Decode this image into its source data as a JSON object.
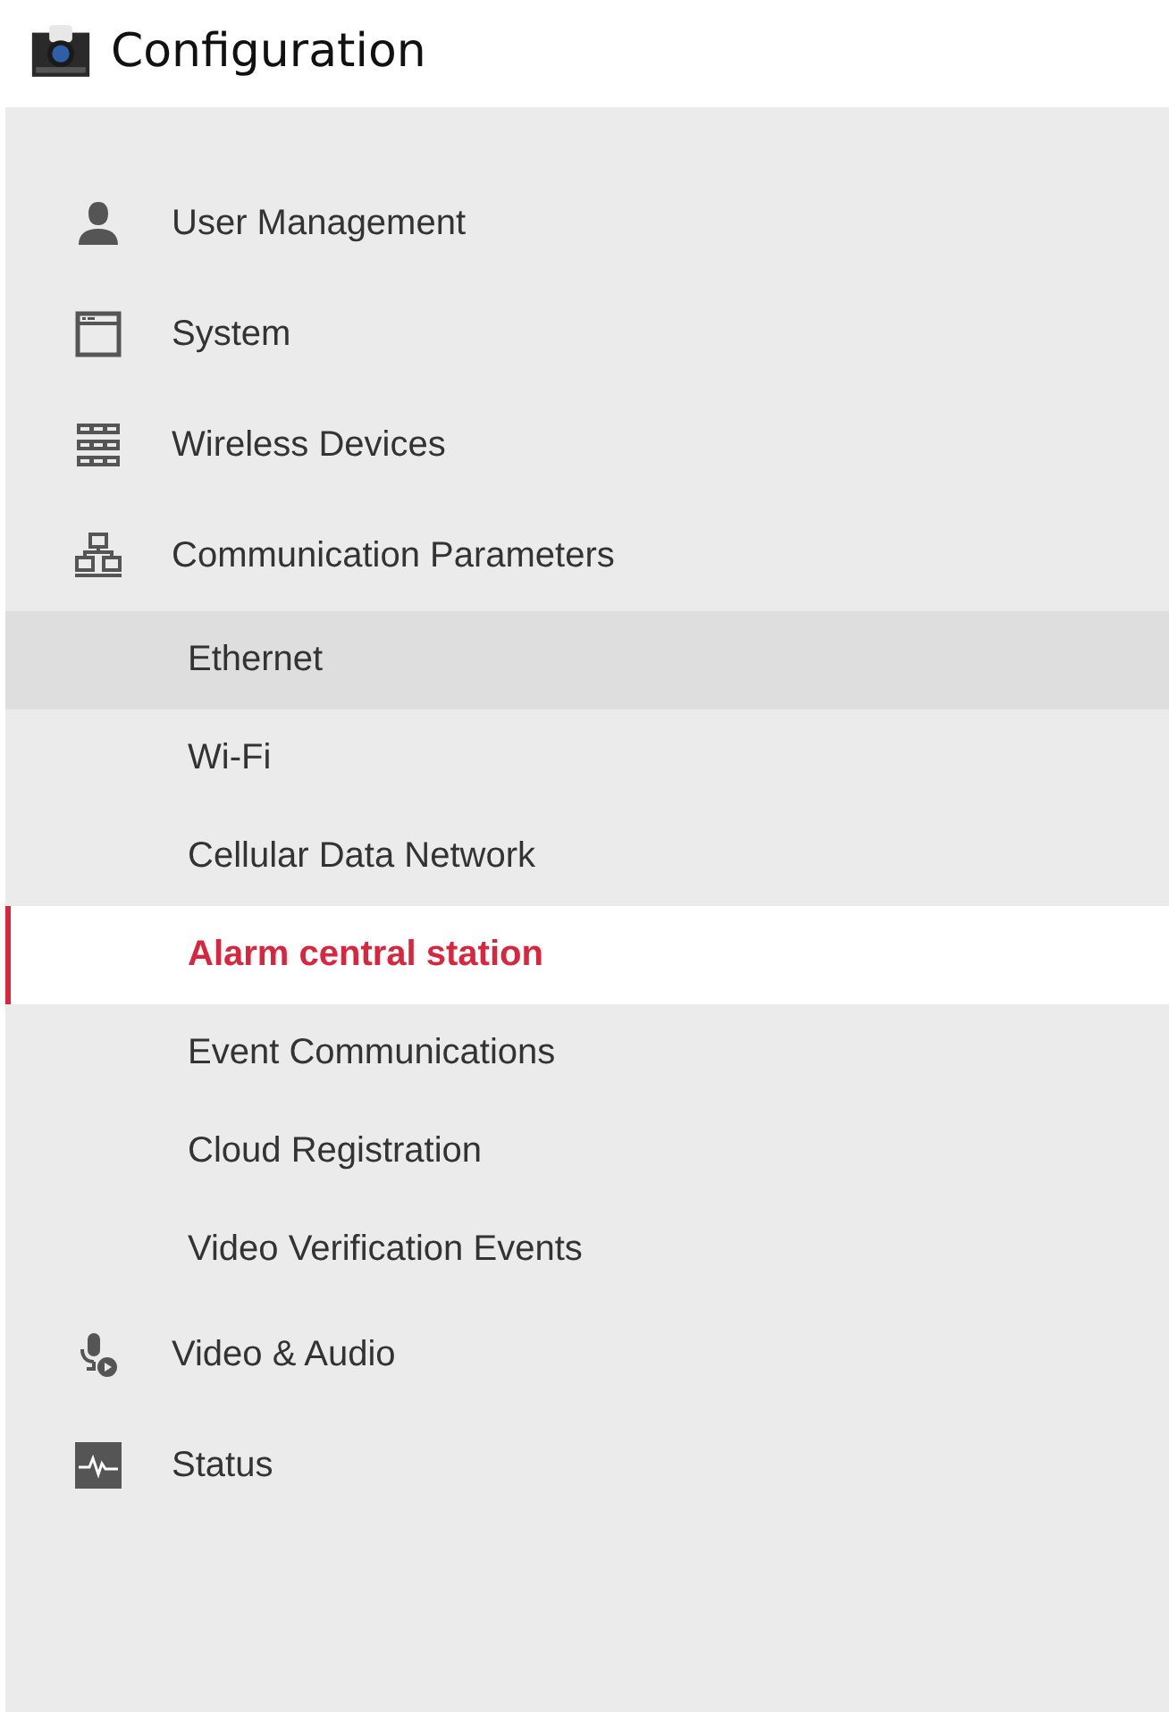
{
  "header": {
    "title": "Configuration"
  },
  "menu": [
    {
      "label": "User Management"
    },
    {
      "label": "System"
    },
    {
      "label": "Wireless Devices"
    },
    {
      "label": "Communication Parameters",
      "children": [
        {
          "label": "Ethernet",
          "selected": false,
          "hovered": true
        },
        {
          "label": "Wi-Fi",
          "selected": false,
          "hovered": false
        },
        {
          "label": "Cellular Data Network",
          "selected": false,
          "hovered": false
        },
        {
          "label": "Alarm central station",
          "selected": true,
          "hovered": false
        },
        {
          "label": "Event Communications",
          "selected": false,
          "hovered": false
        },
        {
          "label": "Cloud Registration",
          "selected": false,
          "hovered": false
        },
        {
          "label": "Video Verification Events",
          "selected": false,
          "hovered": false
        }
      ]
    },
    {
      "label": "Video & Audio"
    },
    {
      "label": "Status"
    }
  ]
}
